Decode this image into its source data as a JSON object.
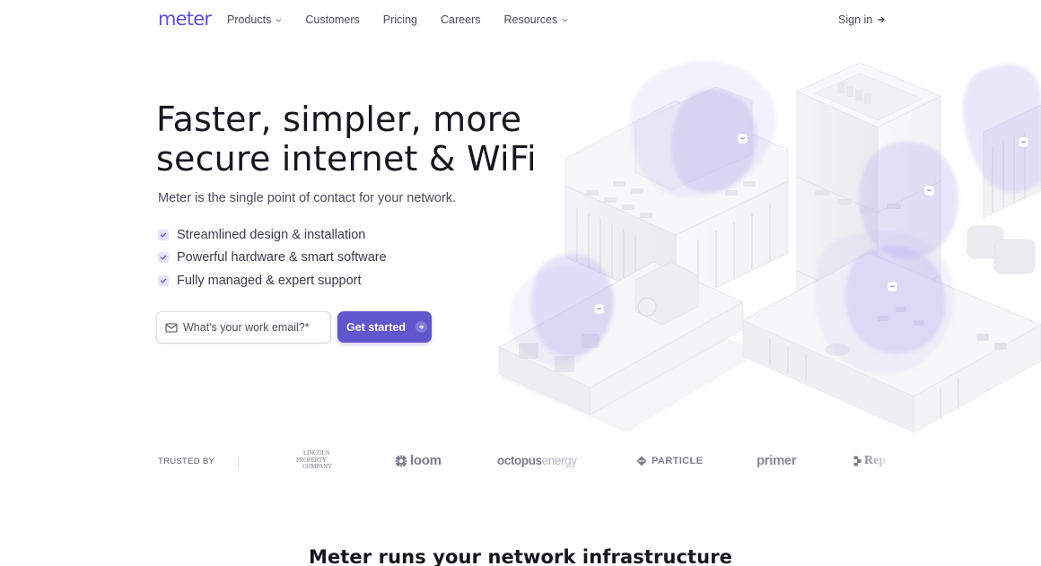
{
  "nav": {
    "logo": "meter",
    "links": [
      {
        "label": "Products",
        "has_dropdown": true,
        "icon": "chevron-down-icon"
      },
      {
        "label": "Customers",
        "has_dropdown": false
      },
      {
        "label": "Pricing",
        "has_dropdown": false
      },
      {
        "label": "Careers",
        "has_dropdown": false
      },
      {
        "label": "Resources",
        "has_dropdown": true,
        "icon": "chevron-down-icon"
      }
    ],
    "sign_in": {
      "label": "Sign in",
      "icon": "arrow-right-icon"
    }
  },
  "hero": {
    "title_line1": "Faster, simpler, more",
    "title_line2": "secure internet & WiFi",
    "subtitle": "Meter is the single point of contact for your network.",
    "features": [
      {
        "label": "Streamlined design & installation",
        "icon": "check-icon"
      },
      {
        "label": "Powerful hardware & smart software",
        "icon": "check-icon"
      },
      {
        "label": "Fully managed & expert support",
        "icon": "check-icon"
      }
    ],
    "email_field": {
      "placeholder": "What's your work email?*",
      "value": "",
      "icon": "mail-icon"
    },
    "cta": {
      "label": "Get started",
      "icon": "arrow-right-circle-icon"
    },
    "illustration": {
      "description": "Isometric buildings with WiFi coverage zones",
      "coverage_color": "#b9b0f2"
    }
  },
  "trusted": {
    "label": "TRUSTED BY",
    "brands": [
      {
        "name": "Lincoln Property Company",
        "lines": [
          "Lincoln",
          "Property",
          "Company"
        ]
      },
      {
        "name": "loom",
        "label": "loom",
        "icon": "loom-burst-icon"
      },
      {
        "name": "octopus energy",
        "bold": "octopus",
        "light": "energy"
      },
      {
        "name": "PARTICLE",
        "label": "PARTICLE",
        "icon": "particle-diamond-icon"
      },
      {
        "name": "primer",
        "label": "primer"
      },
      {
        "name": "Replit",
        "label": "Rep",
        "icon": "replit-icon"
      }
    ]
  },
  "section": {
    "title": "Meter runs your network infrastructure"
  },
  "colors": {
    "brand": "#5b50d6",
    "cta_background": "#6156cc",
    "check_background": "#e5e2fb",
    "text_primary": "#16161f",
    "text_secondary": "#4b4b5c"
  }
}
